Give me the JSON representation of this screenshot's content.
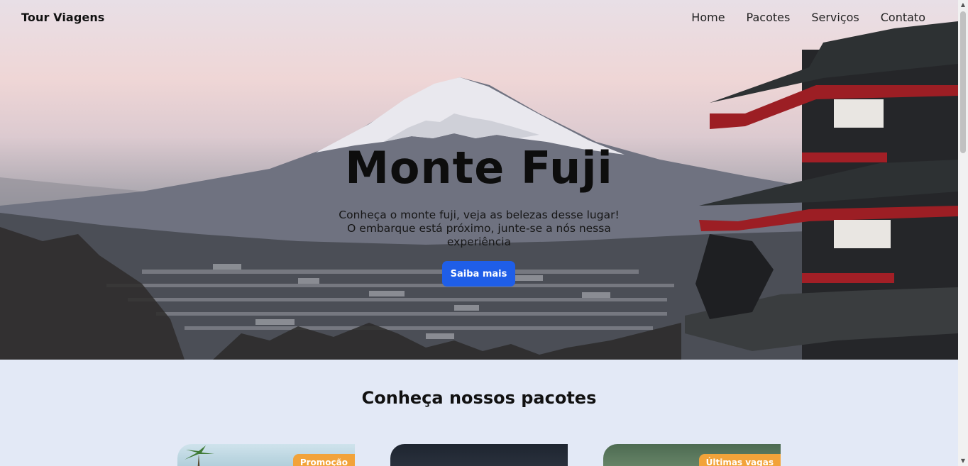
{
  "nav": {
    "brand": "Tour Viagens",
    "items": [
      "Home",
      "Pacotes",
      "Serviços",
      "Contato"
    ]
  },
  "hero": {
    "title": "Monte Fuji",
    "description": "Conheça o monte fuji, veja as belezas desse lugar! O embarque está próximo, junte-se a nós nessa experiência",
    "button_label": "Saiba mais"
  },
  "packages": {
    "title": "Conheça nossos pacotes",
    "cards": [
      {
        "badge": "Promoção"
      },
      {
        "badge": ""
      },
      {
        "badge": "Últimas vagas"
      }
    ]
  },
  "colors": {
    "accent": "#1f5ee8",
    "badge": "#f2a33a",
    "section_bg": "#e3e9f6"
  }
}
